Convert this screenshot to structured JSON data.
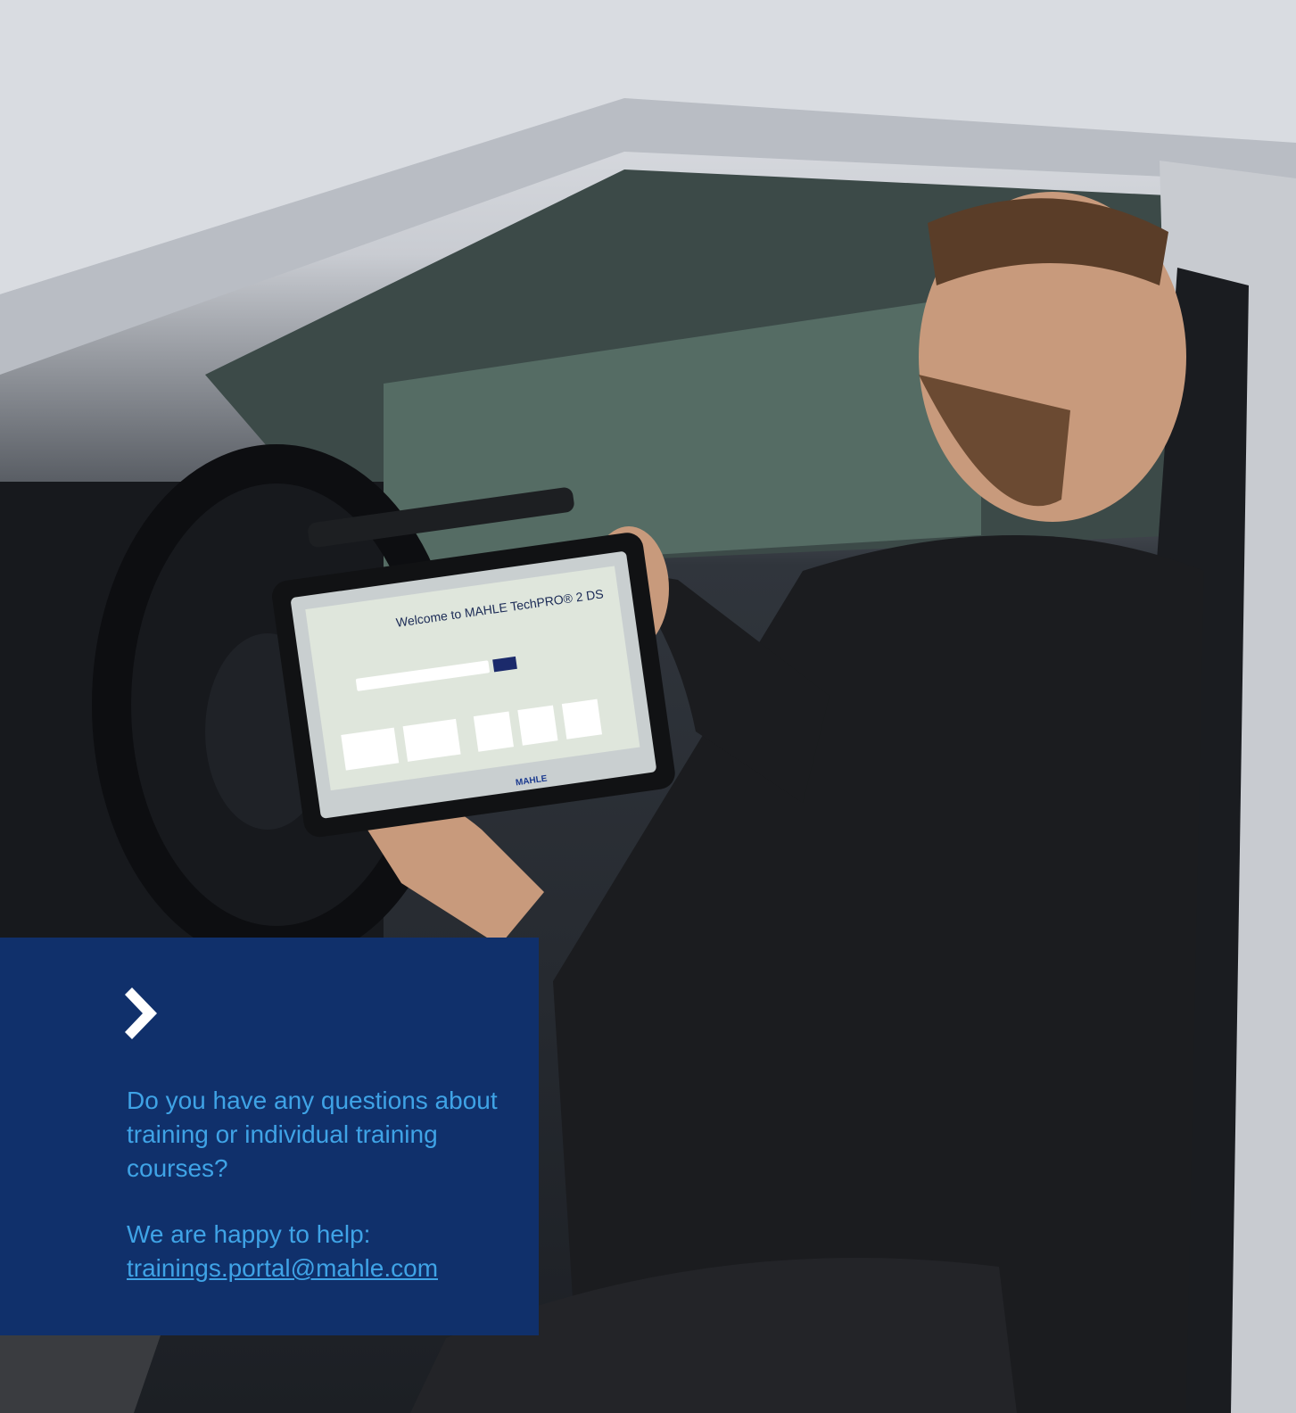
{
  "photo": {
    "icon": "photo-of-technician-with-tablet",
    "tablet_screen": {
      "title": "Welcome to MAHLE TechPRO® 2 DS",
      "brand": "MAHLE"
    }
  },
  "cta": {
    "icon": "chevron-right-icon",
    "question": "Do you have any questions about training or individual training courses?",
    "help_text": "We are happy to help:",
    "email": "trainings.portal@mahle.com",
    "colors": {
      "panel_bg": "#10306b",
      "text": "#3fa3e6",
      "chevron": "#ffffff"
    }
  }
}
